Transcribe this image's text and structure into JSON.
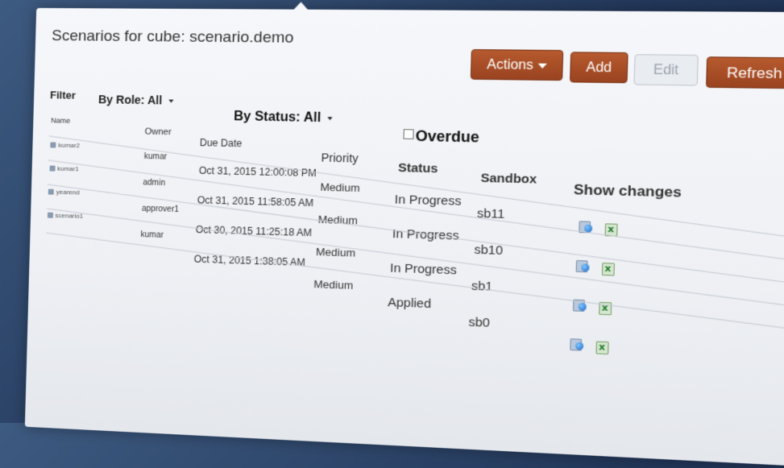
{
  "window": {
    "title": "Scenarios for cube: scenario.demo"
  },
  "toolbar": {
    "actions_label": "Actions",
    "add_label": "Add",
    "edit_label": "Edit",
    "refresh_label": "Refresh"
  },
  "filters": {
    "label": "Filter",
    "role_label": "By Role: All",
    "status_label": "By Status: All",
    "overdue_label": "Overdue",
    "overdue_checked": false
  },
  "table": {
    "columns": [
      "Name",
      "Owner",
      "Due Date",
      "Priority",
      "Status",
      "Sandbox",
      "Show changes"
    ],
    "rows": [
      {
        "name": "kumar2",
        "owner": "kumar",
        "due": "Oct 31, 2015 12:00:08 PM",
        "priority": "Medium",
        "status": "In Progress",
        "sandbox": "sb11"
      },
      {
        "name": "kumar1",
        "owner": "admin",
        "due": "Oct 31, 2015 11:58:05 AM",
        "priority": "Medium",
        "status": "In Progress",
        "sandbox": "sb10"
      },
      {
        "name": "yearend",
        "owner": "approver1",
        "due": "Oct 30, 2015 11:25:18 AM",
        "priority": "Medium",
        "status": "In Progress",
        "sandbox": "sb1"
      },
      {
        "name": "scenario1",
        "owner": "kumar",
        "due": "Oct 31, 2015 1:38:05 AM",
        "priority": "Medium",
        "status": "Applied",
        "sandbox": "sb0"
      }
    ]
  },
  "icons": {
    "show_changes_sandbox": "sandbox-globe-icon",
    "show_changes_excel": "excel-icon"
  },
  "colors": {
    "primary_button": "#a84d25",
    "disabled_button": "#e9ecf0",
    "background": "#2b4268"
  }
}
